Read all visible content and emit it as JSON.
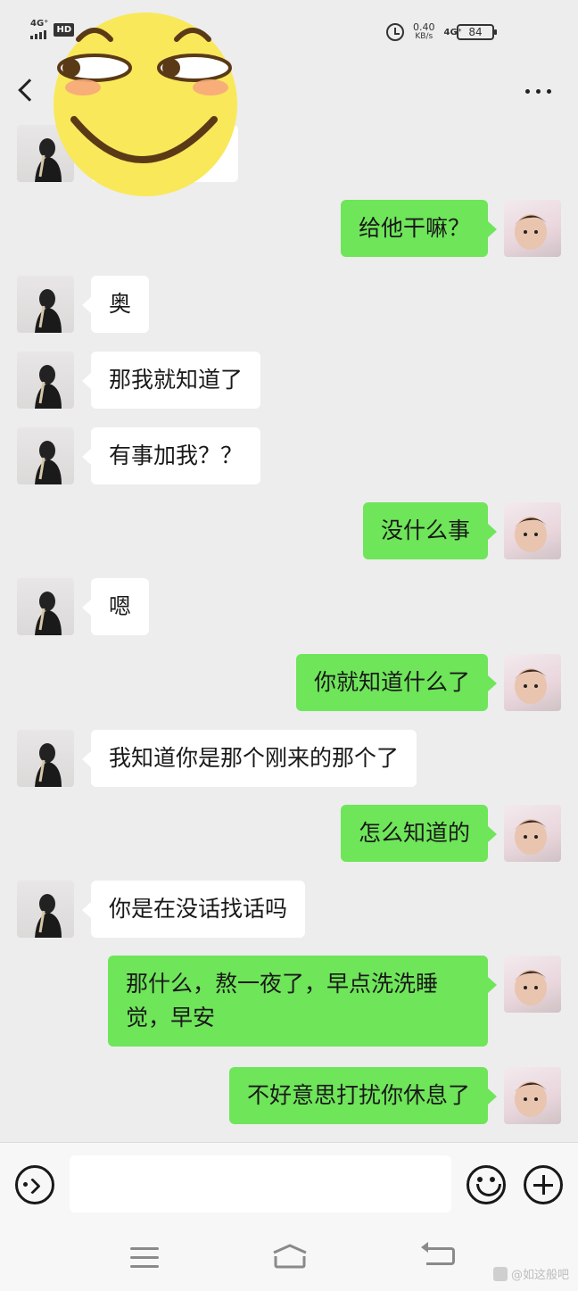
{
  "status_bar": {
    "signal_label": "4G⁺",
    "hd_label": "HD",
    "net_speed_value": "0.40",
    "net_speed_unit": "KB/s",
    "net_type": "4G⁺",
    "battery": "84"
  },
  "messages": [
    {
      "side": "left",
      "text": ""
    },
    {
      "side": "right",
      "text": "给他干嘛？"
    },
    {
      "side": "left",
      "text": "奥"
    },
    {
      "side": "left",
      "text": "那我就知道了"
    },
    {
      "side": "left",
      "text": "有事加我？？"
    },
    {
      "side": "right",
      "text": "没什么事"
    },
    {
      "side": "left",
      "text": "嗯"
    },
    {
      "side": "right",
      "text": "你就知道什么了"
    },
    {
      "side": "left",
      "text": "我知道你是那个刚来的那个了"
    },
    {
      "side": "right",
      "text": "怎么知道的"
    },
    {
      "side": "left",
      "text": "你是在没话找话吗"
    },
    {
      "side": "right",
      "text": "那什么，熬一夜了，早点洗洗睡觉，早安"
    },
    {
      "side": "right",
      "text": "不好意思打扰你休息了"
    }
  ],
  "input": {
    "value": "",
    "placeholder": ""
  },
  "watermark": "@如这般吧",
  "colors": {
    "background": "#ededed",
    "sent_bubble": "#6fe55a",
    "received_bubble": "#ffffff"
  }
}
